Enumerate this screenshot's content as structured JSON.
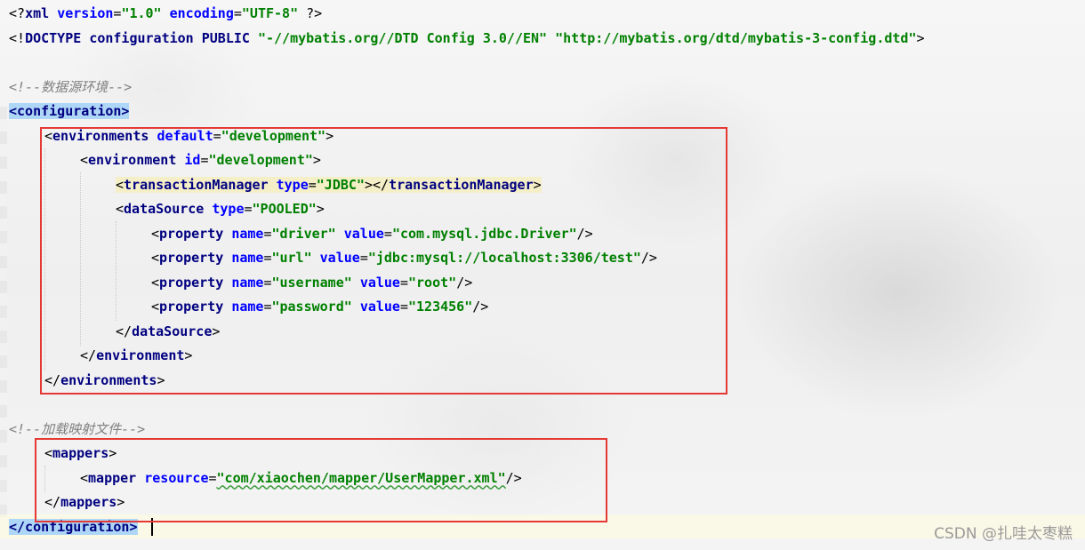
{
  "editor": {
    "language": "xml",
    "lines": {
      "l1": {
        "lt_q": "<?",
        "name": "xml",
        "a1": "version",
        "eq1": "=",
        "v1": "\"1.0\"",
        "a2": "encoding",
        "eq2": "=",
        "v2": "\"UTF-8\"",
        "end": "?>"
      },
      "l2": {
        "lt": "<!",
        "name": "DOCTYPE",
        "rest1": "configuration",
        "rest2": "PUBLIC",
        "v1": "\"-//mybatis.org//DTD Config 3.0//EN\"",
        "v2": "\"http://mybatis.org/dtd/mybatis-3-config.dtd\"",
        "gt": ">"
      },
      "l4": {
        "comment": "<!--数据源环境-->"
      },
      "l5": {
        "open": "<configuration>"
      },
      "l6": {
        "lt": "<",
        "name": "environments",
        "attr": "default",
        "eq": "=",
        "val": "\"development\"",
        "gt": ">"
      },
      "l7": {
        "lt": "<",
        "name": "environment",
        "attr": "id",
        "eq": "=",
        "val": "\"development\"",
        "gt": ">"
      },
      "l8": {
        "lt": "<",
        "name": "transactionManager",
        "attr": "type",
        "eq": "=",
        "val": "\"JDBC\"",
        "mid": "></",
        "close": "transactionManager",
        "gt": ">"
      },
      "l9": {
        "lt": "<",
        "name": "dataSource",
        "attr": "type",
        "eq": "=",
        "val": "\"POOLED\"",
        "gt": ">"
      },
      "l10": {
        "lt": "<",
        "name": "property",
        "a1": "name",
        "eq1": "=",
        "v1": "\"driver\"",
        "a2": "value",
        "eq2": "=",
        "v2": "\"com.mysql.jdbc.Driver\"",
        "end": "/>"
      },
      "l11": {
        "lt": "<",
        "name": "property",
        "a1": "name",
        "eq1": "=",
        "v1": "\"url\"",
        "a2": "value",
        "eq2": "=",
        "v2": "\"jdbc:mysql://localhost:3306/test\"",
        "end": "/>"
      },
      "l12": {
        "lt": "<",
        "name": "property",
        "a1": "name",
        "eq1": "=",
        "v1": "\"username\"",
        "a2": "value",
        "eq2": "=",
        "v2": "\"root\"",
        "end": "/>"
      },
      "l13": {
        "lt": "<",
        "name": "property",
        "a1": "name",
        "eq1": "=",
        "v1": "\"password\"",
        "a2": "value",
        "eq2": "=",
        "v2": "\"123456\"",
        "end": "/>"
      },
      "l14": {
        "lt": "</",
        "name": "dataSource",
        "gt": ">"
      },
      "l15": {
        "lt": "</",
        "name": "environment",
        "gt": ">"
      },
      "l16": {
        "lt": "</",
        "name": "environments",
        "gt": ">"
      },
      "l18": {
        "comment": "<!--加载映射文件-->"
      },
      "l19": {
        "lt": "<",
        "name": "mappers",
        "gt": ">"
      },
      "l20": {
        "lt": "<",
        "name": "mapper",
        "attr": "resource",
        "eq": "=",
        "val": "\"com/xiaochen/mapper/UserMapper.xml\"",
        "end": "/>"
      },
      "l21": {
        "lt": "</",
        "name": "mappers",
        "gt": ">"
      },
      "l22": {
        "close": "</configuration>"
      }
    }
  },
  "colors": {
    "highlight_box": "#e53935",
    "tag": "#000080",
    "attribute": "#0000ff",
    "value": "#008000",
    "comment": "#808080",
    "matched_tag_bg": "#aed7f7"
  },
  "watermark": "CSDN @扎哇太枣糕"
}
